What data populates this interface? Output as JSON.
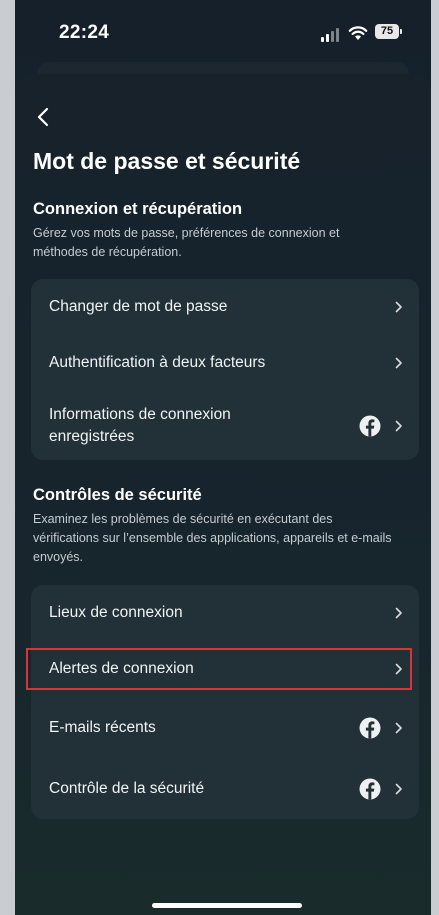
{
  "status": {
    "time": "22:24",
    "battery": "75"
  },
  "page": {
    "title": "Mot de passe et sécurité"
  },
  "login_section": {
    "title": "Connexion et récupération",
    "description": "Gérez vos mots de passe, préférences de connexion et méthodes de récupération.",
    "items": [
      {
        "label": "Changer de mot de passe",
        "facebook_icon": false
      },
      {
        "label": "Authentification à deux facteurs",
        "facebook_icon": false
      },
      {
        "label": "Informations de connexion enregistrées",
        "facebook_icon": true
      }
    ]
  },
  "security_section": {
    "title": "Contrôles de sécurité",
    "description": "Examinez les problèmes de sécurité en exécutant des vérifications sur l’ensemble des applications, appareils et e-mails envoyés.",
    "items": [
      {
        "label": "Lieux de connexion",
        "facebook_icon": false
      },
      {
        "label": "Alertes de connexion",
        "facebook_icon": false,
        "highlighted": true
      },
      {
        "label": "E-mails récents",
        "facebook_icon": true
      },
      {
        "label": "Contrôle de la sécurité",
        "facebook_icon": true
      }
    ]
  },
  "colors": {
    "highlight": "#d93538",
    "card": "#223038",
    "background": "#17222b"
  }
}
